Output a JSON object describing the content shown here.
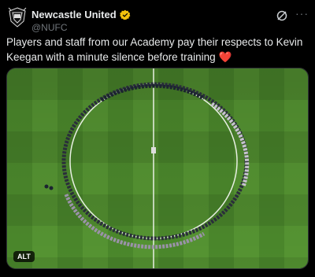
{
  "account": {
    "display_name": "Newcastle United",
    "handle": "@NUFC",
    "verified_badge_color": "#F4C20D",
    "avatar_icon": "newcastle-crest-icon"
  },
  "actions": {
    "grok_icon": "grok-icon",
    "more_label": "···"
  },
  "tweet": {
    "text": "Players and staff from our Academy pay their respects to Kevin Keegan with a minute silence before training",
    "emoji": "❤️"
  },
  "media": {
    "alt_label": "ALT",
    "description_colors": {
      "pitch_light": "#5fa238",
      "pitch_dark": "#4d8c2c",
      "lines": "#e8efe3"
    }
  },
  "theme": {
    "background": "#000000",
    "text": "#e7e9ea",
    "muted": "#71767b",
    "heart": "#f91880"
  }
}
